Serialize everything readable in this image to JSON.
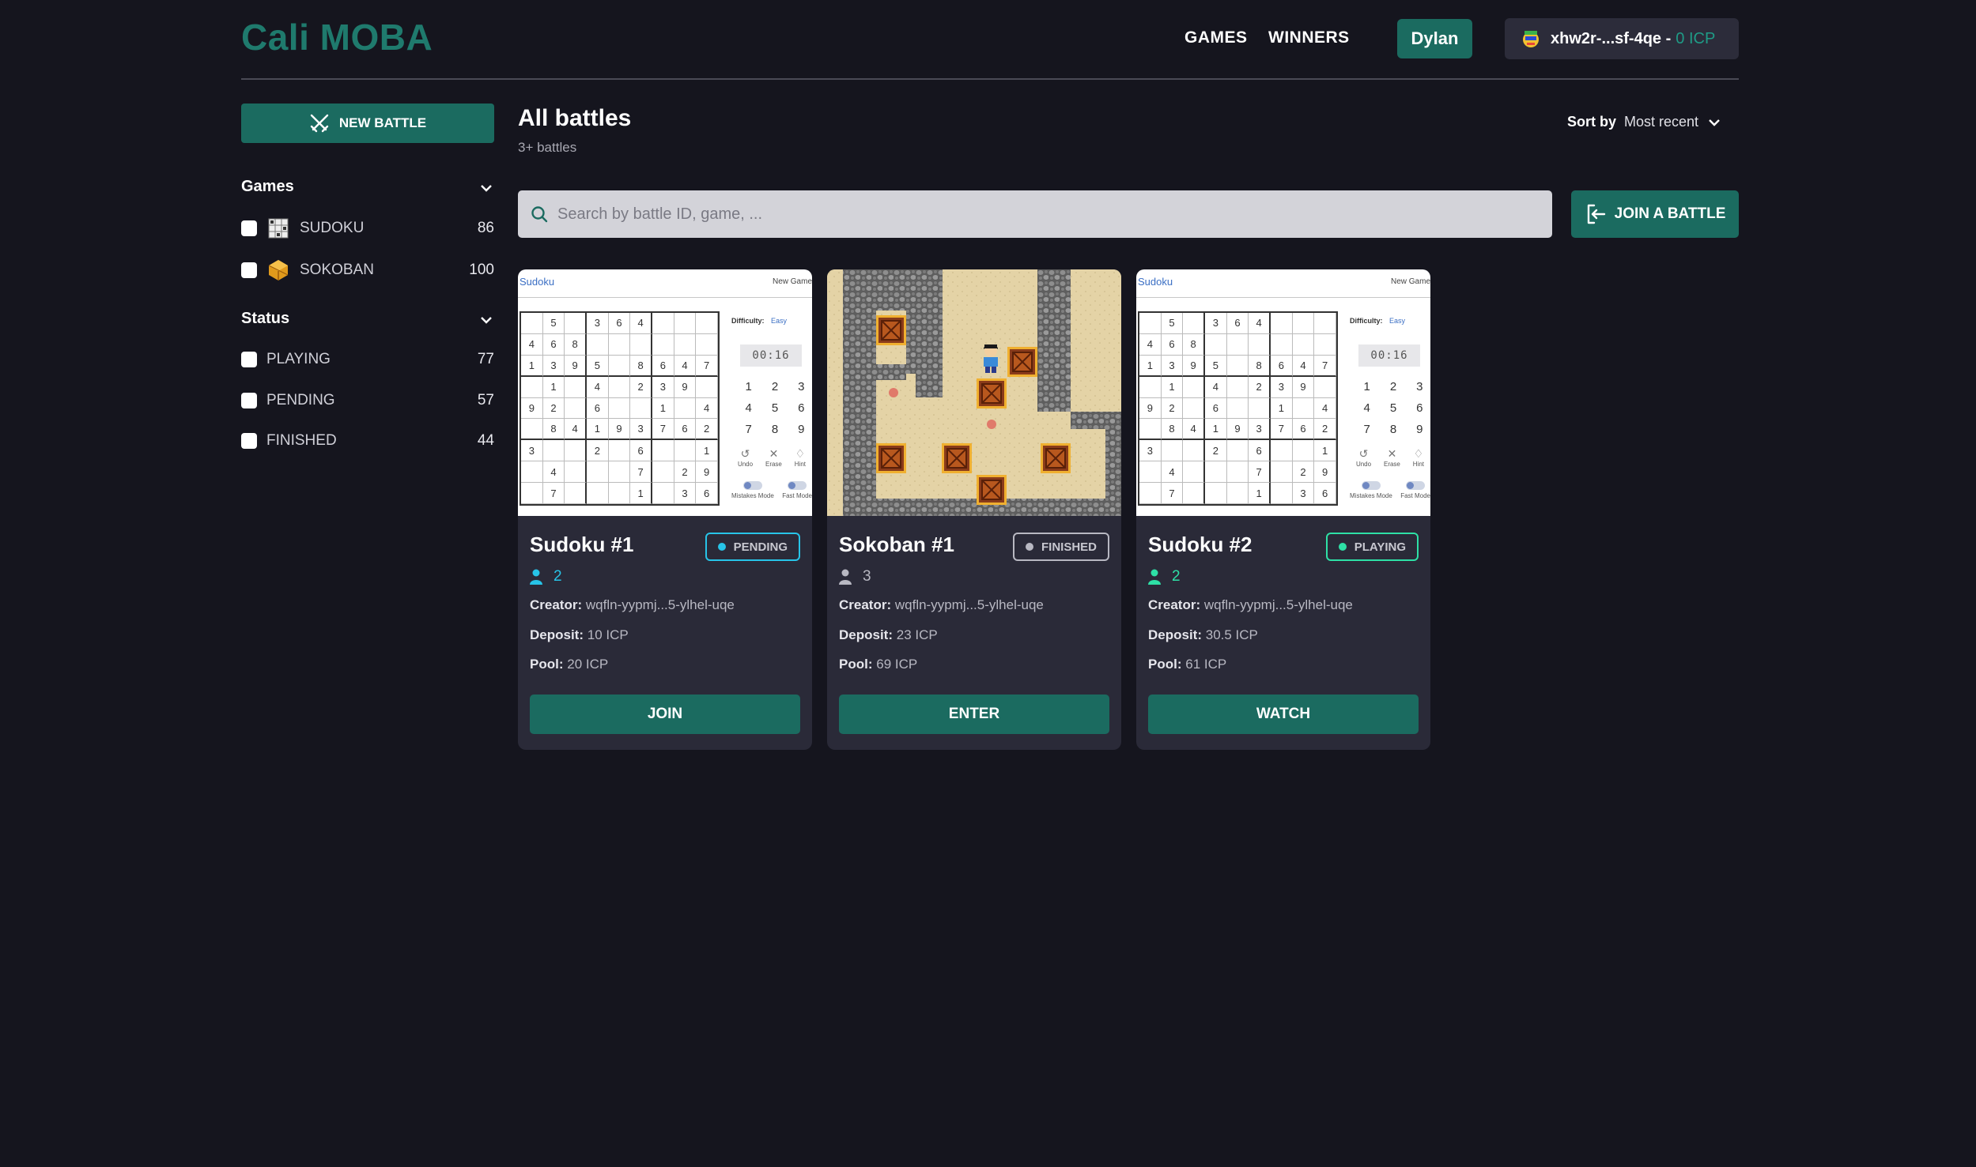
{
  "app": {
    "title": "Cali MOBA"
  },
  "nav": {
    "games": "GAMES",
    "winners": "WINNERS"
  },
  "user": {
    "name": "Dylan"
  },
  "wallet": {
    "principal": "xhw2r-...sf-4qe - ",
    "balance": "0 ICP"
  },
  "sidebar": {
    "new_battle_label": "NEW BATTLE",
    "games_heading": "Games",
    "games": [
      {
        "label": "SUDOKU",
        "count": "86",
        "icon": "sudoku-icon"
      },
      {
        "label": "SOKOBAN",
        "count": "100",
        "icon": "sokoban-icon"
      }
    ],
    "status_heading": "Status",
    "statuses": [
      {
        "label": "PLAYING",
        "count": "77"
      },
      {
        "label": "PENDING",
        "count": "57"
      },
      {
        "label": "FINISHED",
        "count": "44"
      }
    ]
  },
  "main": {
    "title": "All battles",
    "subtitle": "3+ battles",
    "sort_label": "Sort by",
    "sort_value": "Most recent",
    "search_placeholder": "Search by battle ID, game, ...",
    "join_label": "JOIN A BATTLE"
  },
  "labels": {
    "creator": "Creator:",
    "deposit": "Deposit:",
    "pool": "Pool:"
  },
  "sudoku_thumb": {
    "title": "Sudoku",
    "new_game": "New Game",
    "difficulty_label": "Difficulty:",
    "difficulty_value": "Easy",
    "timer": "00:16",
    "pad": [
      "1",
      "2",
      "3",
      "4",
      "5",
      "6",
      "7",
      "8",
      "9"
    ],
    "tools": [
      "Undo",
      "Erase",
      "Hint"
    ],
    "toggles": [
      "Mistakes Mode",
      "Fast Mode"
    ],
    "grid": [
      [
        "",
        "5",
        "",
        "3",
        "6",
        "4",
        "",
        "",
        ""
      ],
      [
        "4",
        "6",
        "8",
        "",
        "",
        "",
        "",
        "",
        ""
      ],
      [
        "1",
        "3",
        "9",
        "5",
        "",
        "8",
        "6",
        "4",
        "7"
      ],
      [
        "",
        "1",
        "",
        "4",
        "",
        "2",
        "3",
        "9",
        ""
      ],
      [
        "9",
        "2",
        "",
        "6",
        "",
        "",
        "1",
        "",
        "4"
      ],
      [
        "",
        "8",
        "4",
        "1",
        "9",
        "3",
        "7",
        "6",
        "2"
      ],
      [
        "3",
        "",
        "",
        "2",
        "",
        "6",
        "",
        "",
        "1"
      ],
      [
        "",
        "4",
        "",
        "",
        "",
        "7",
        "",
        "2",
        "9"
      ],
      [
        "",
        "7",
        "",
        "",
        "",
        "1",
        "",
        "3",
        "6"
      ]
    ]
  },
  "cards": [
    {
      "title": "Sudoku #1",
      "status": "PENDING",
      "status_color": "#27c4e8",
      "players": "2",
      "players_color": "#27c4e8",
      "creator": "wqfln-yypmj...5-ylhel-uqe",
      "deposit": "10 ICP",
      "pool": "20 ICP",
      "action": "JOIN"
    },
    {
      "title": "Sokoban #1",
      "status": "FINISHED",
      "status_color": "#b8b8c2",
      "players": "3",
      "players_color": "#b8b8c2",
      "creator": "wqfln-yypmj...5-ylhel-uqe",
      "deposit": "23 ICP",
      "pool": "69 ICP",
      "action": "ENTER"
    },
    {
      "title": "Sudoku #2",
      "status": "PLAYING",
      "status_color": "#2ee0a6",
      "players": "2",
      "players_color": "#2ee0a6",
      "creator": "wqfln-yypmj...5-ylhel-uqe",
      "deposit": "30.5 ICP",
      "pool": "61 ICP",
      "action": "WATCH"
    }
  ]
}
